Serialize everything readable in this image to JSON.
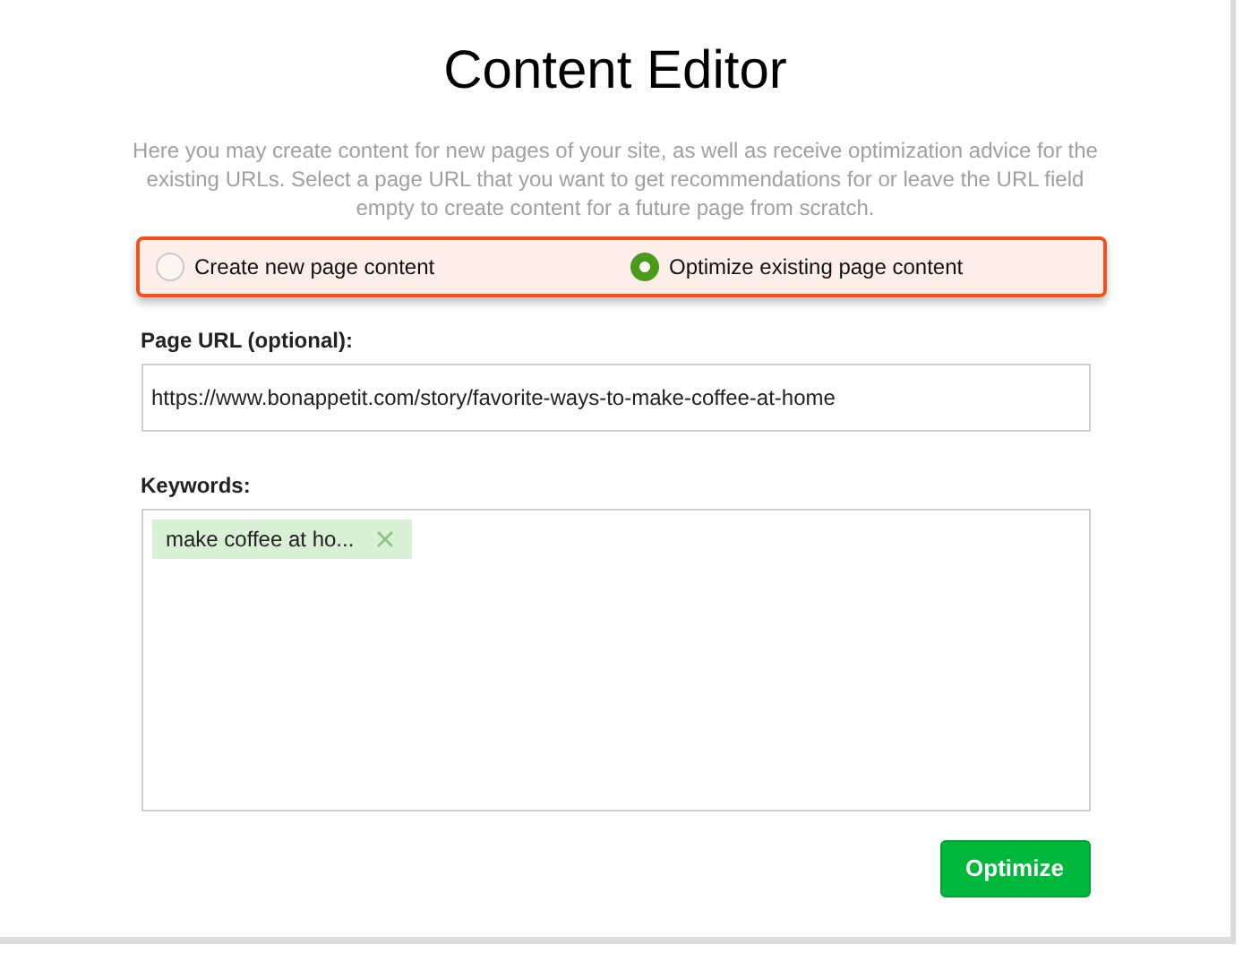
{
  "title": "Content Editor",
  "description": "Here you may create content for new pages of your site, as well as receive optimization advice for the existing URLs. Select a page URL that you want to get recommendations for or leave the URL field empty to create content for a future page from scratch.",
  "modes": [
    {
      "label": "Create new page content",
      "selected": false
    },
    {
      "label": "Optimize existing page content",
      "selected": true
    }
  ],
  "url_field": {
    "label": "Page URL (optional):",
    "value": "https://www.bonappetit.com/story/favorite-ways-to-make-coffee-at-home"
  },
  "keywords": {
    "label": "Keywords:",
    "tags": [
      {
        "text": "make coffee at ho..."
      }
    ]
  },
  "button": "Optimize"
}
